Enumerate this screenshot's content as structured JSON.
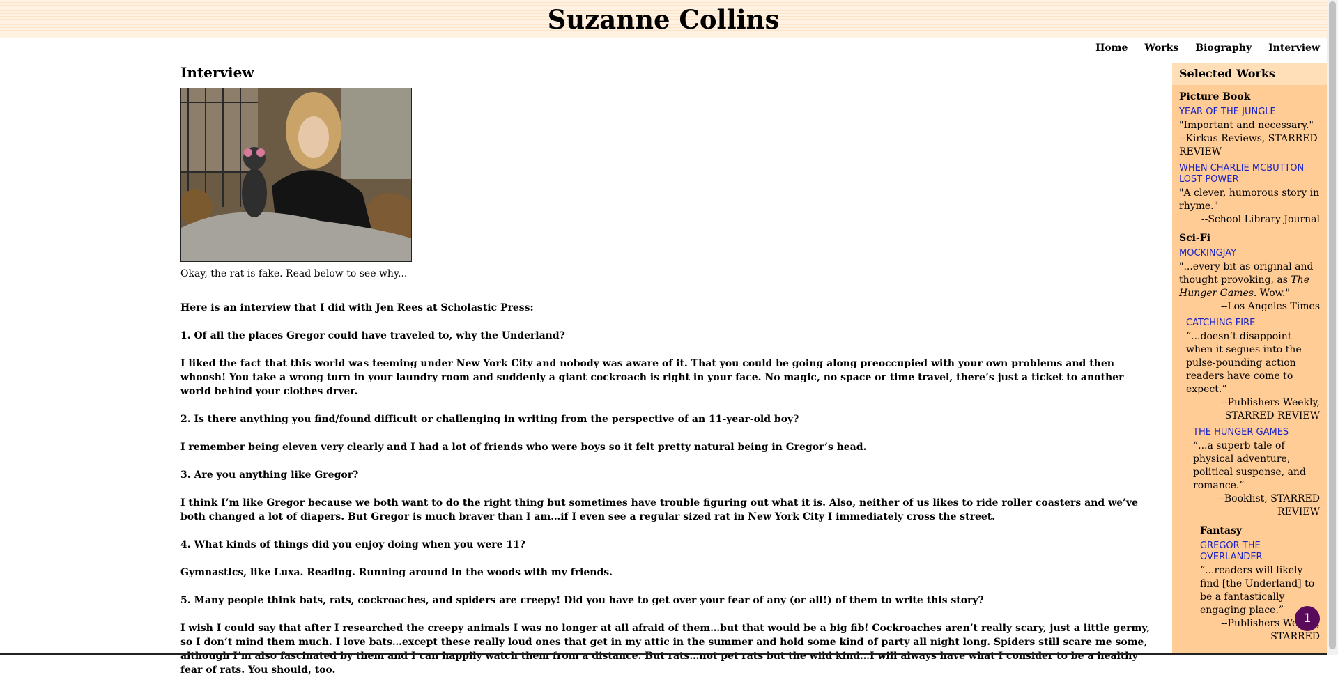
{
  "site": {
    "title": "Suzanne Collins"
  },
  "nav": {
    "items": [
      "Home",
      "Works",
      "Biography",
      "Interview"
    ]
  },
  "main": {
    "heading": "Interview",
    "photo_caption": "Okay, the rat is fake. Read below to see why...",
    "intro": "Here is an interview that I did with Jen Rees at Scholastic Press:",
    "qa": [
      "1. Of all the places Gregor could have traveled to, why the Underland?",
      "I liked the fact that this world was teeming under New York City and nobody was aware of it. That you could be going along preoccupied with your own problems and then whoosh! You take a wrong turn in your laundry room and suddenly a giant cockroach is right in your face. No magic, no space or time travel, there’s just a ticket to another world behind your clothes dryer.",
      "2. Is there anything you find/found difficult or challenging in writing from the perspective of an 11-year-old boy?",
      "I remember being eleven very clearly and I had a lot of friends who were boys so it felt pretty natural being in Gregor’s head.",
      "3. Are you anything like Gregor?",
      "I think I’m like Gregor because we both want to do the right thing but sometimes have trouble figuring out what it is. Also, neither of us likes to ride roller coasters and we’ve both changed a lot of diapers. But Gregor is much braver than I am…if I even see a regular sized rat in New York City I immediately cross the street.",
      "4. What kinds of things did you enjoy doing when you were 11?",
      "Gymnastics, like Luxa. Reading. Running around in the woods with my friends.",
      "5. Many people think bats, rats, cockroaches, and spiders are creepy! Did you have to get over your fear of any (or all!) of them to write this story?",
      "I wish I could say that after I researched the creepy animals I was no longer at all afraid of them…but that would be a big fib! Cockroaches aren’t really scary, just a little germy, so I don’t mind them much. I love bats…except these really loud ones that get in my attic in the summer and hold some kind of party all night long. Spiders still scare me some, although I’m also fascinated by them and I can happily watch them from a distance. But rats…not pet rats but the wild kind…I will always have what I consider to be a healthy fear of rats. You should, too."
    ]
  },
  "sidebar": {
    "title": "Selected Works",
    "picture_book": {
      "category": "Picture Book",
      "books": [
        {
          "title": "YEAR OF THE JUNGLE",
          "quote": "\"Important and necessary.\"",
          "source": "--Kirkus Reviews, STARRED REVIEW"
        },
        {
          "title": "WHEN CHARLIE MCBUTTON LOST POWER",
          "quote": "\"A clever, humorous story in rhyme.\"",
          "source": "--School Library Journal"
        }
      ]
    },
    "scifi": {
      "category": "Sci-Fi",
      "mockingjay": {
        "title": "MOCKINGJAY",
        "quote_a": "\"...every bit as original and thought provoking, as ",
        "quote_italic": "The Hunger Games.",
        "quote_b": " Wow.\"",
        "source": "--Los Angeles Times"
      },
      "catching_fire": {
        "title": "CATCHING FIRE",
        "quote": "“...doesn’t disappoint when it segues into the pulse-pounding action readers have come to expect.”",
        "source": "--Publishers Weekly, STARRED REVIEW"
      },
      "hunger_games": {
        "title": "THE HUNGER GAMES",
        "quote": "“...a superb tale of physical adventure, political suspense, and romance.”",
        "source": "--Booklist, STARRED REVIEW"
      }
    },
    "fantasy": {
      "category": "Fantasy",
      "gregor": {
        "title": "GREGOR THE OVERLANDER",
        "quote": "“...readers will likely find [the Underland] to be a fantastically engaging place.”",
        "source": "--Publishers Weekly, STARRED"
      }
    }
  },
  "chat": {
    "badge": "1"
  },
  "colors": {
    "sidebar_bg": "#ffcc96",
    "sidebar_title_bg": "#ffdfb8",
    "link": "#1a22c6",
    "chat": "#5a0a5a"
  }
}
